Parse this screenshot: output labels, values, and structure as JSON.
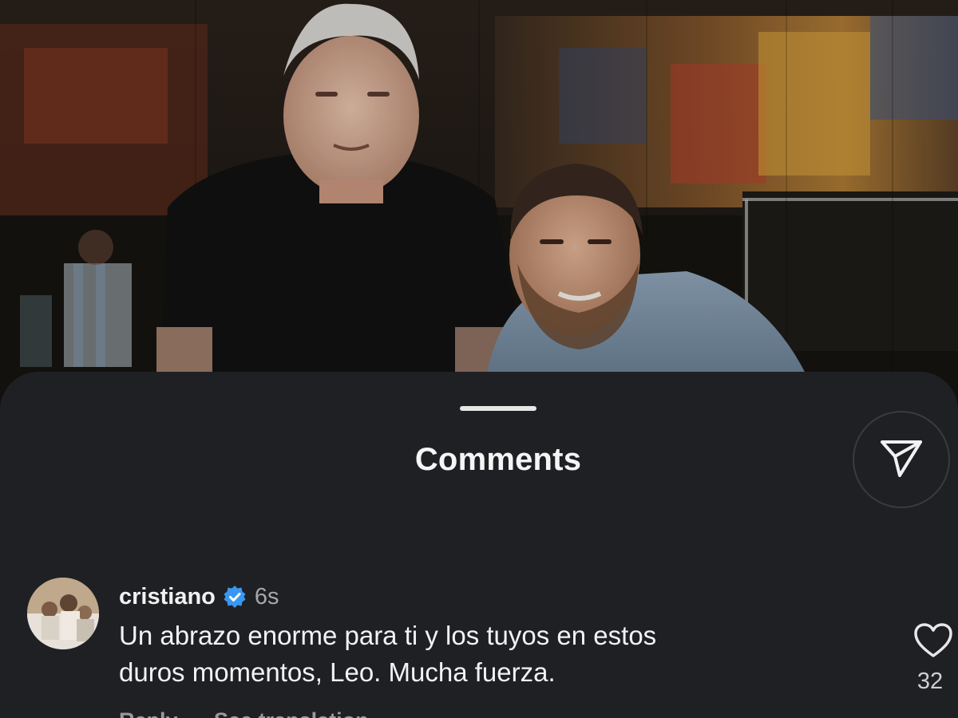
{
  "sheet": {
    "title": "Comments"
  },
  "icons": {
    "share": "paper-plane-icon",
    "verified": "verified-badge-icon",
    "like": "heart-outline-icon"
  },
  "comment": {
    "username": "cristiano",
    "verified": true,
    "timestamp": "6s",
    "text_line1": "Un abrazo enorme para ti y los tuyos en estos",
    "text_line2": "duros momentos, Leo. Mucha fuerza.",
    "reply_label": "Reply",
    "translation_label": "See translation",
    "like_count": "32"
  },
  "colors": {
    "sheet_background": "#1f2024",
    "verified_blue": "#3897f0",
    "text_primary": "#f2f2f2",
    "text_secondary": "#a8a8a8"
  }
}
